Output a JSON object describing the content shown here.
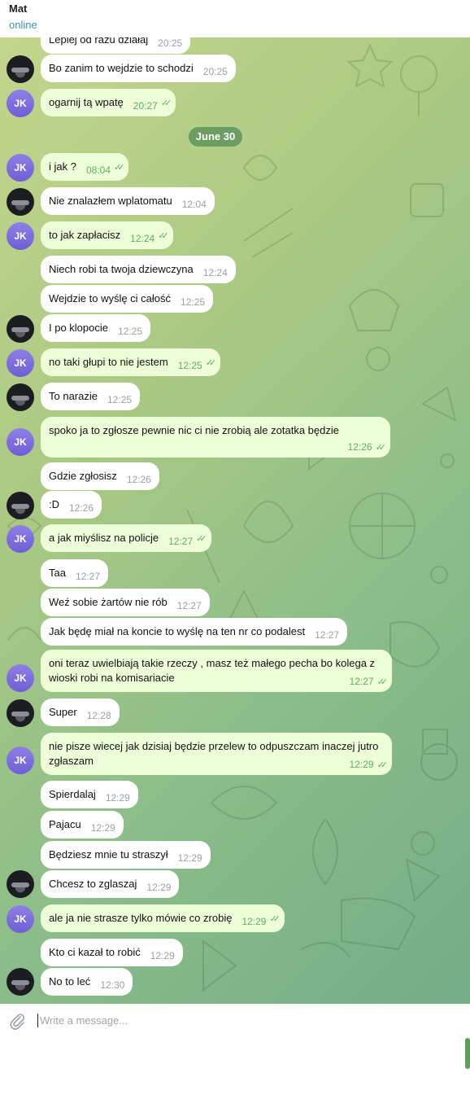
{
  "header": {
    "name": "Mat",
    "status": "online"
  },
  "date_label": "June 30",
  "composer": {
    "placeholder": "Write a message..."
  },
  "messages": [
    {
      "text": "Lepiej od razu działaj",
      "time": "20:25"
    },
    {
      "text": "Bo zanim to wejdzie to schodzi",
      "time": "20:25"
    },
    {
      "text": "ogarnij tą wpatę",
      "time": "20:27"
    },
    {
      "text": "i jak ?",
      "time": "08:04"
    },
    {
      "text": "Nie znalazłem wplatomatu",
      "time": "12:04"
    },
    {
      "text": "to jak zapłacisz",
      "time": "12:24"
    },
    {
      "text": "Niech robi ta twoja dziewczyna",
      "time": "12:24"
    },
    {
      "text": "Wejdzie to wyślę ci całość",
      "time": "12:25"
    },
    {
      "text": "I po klopocie",
      "time": "12:25"
    },
    {
      "text": "no taki głupi to nie jestem",
      "time": "12:25"
    },
    {
      "text": "To narazie",
      "time": "12:25"
    },
    {
      "text": "spoko ja to zgłosze pewnie nic ci nie zrobią ale zotatka będzie",
      "time": "12:26"
    },
    {
      "text": "Gdzie zgłosisz",
      "time": "12:26"
    },
    {
      "text": ":D",
      "time": "12:26"
    },
    {
      "text": "a jak miyślisz na policje",
      "time": "12:27"
    },
    {
      "text": "Taa",
      "time": "12:27"
    },
    {
      "text": "Weź sobie żartów nie rób",
      "time": "12:27"
    },
    {
      "text": "Jak będę miał na koncie to wyślę na ten nr co podalest",
      "time": "12:27"
    },
    {
      "text": "oni teraz uwielbiają takie rzeczy , masz też małego pecha bo kolega z wioski robi na komisariacie",
      "time": "12:27"
    },
    {
      "text": "Super",
      "time": "12:28"
    },
    {
      "text": "nie pisze wiecej jak dzisiaj będzie przelew to odpuszczam inaczej jutro zgłaszam",
      "time": "12:29"
    },
    {
      "text": "Spierdalaj",
      "time": "12:29"
    },
    {
      "text": "Pajacu",
      "time": "12:29"
    },
    {
      "text": "Będziesz mnie tu straszył",
      "time": "12:29"
    },
    {
      "text": "Chcesz to zglaszaj",
      "time": "12:29"
    },
    {
      "text": "ale ja nie strasze tylko mówie co zrobię",
      "time": "12:29"
    },
    {
      "text": "Kto ci kazał to robić",
      "time": "12:29"
    },
    {
      "text": "No to leć",
      "time": "12:30"
    }
  ],
  "avatar_initials": "JK",
  "check_glyph": "✓✓",
  "colors": {
    "incoming_bubble": "#ffffff",
    "outgoing_bubble": "#eefed9",
    "read_check": "#5fae5f",
    "date_pill": "#6e9d63",
    "status": "#3a8fc7"
  }
}
